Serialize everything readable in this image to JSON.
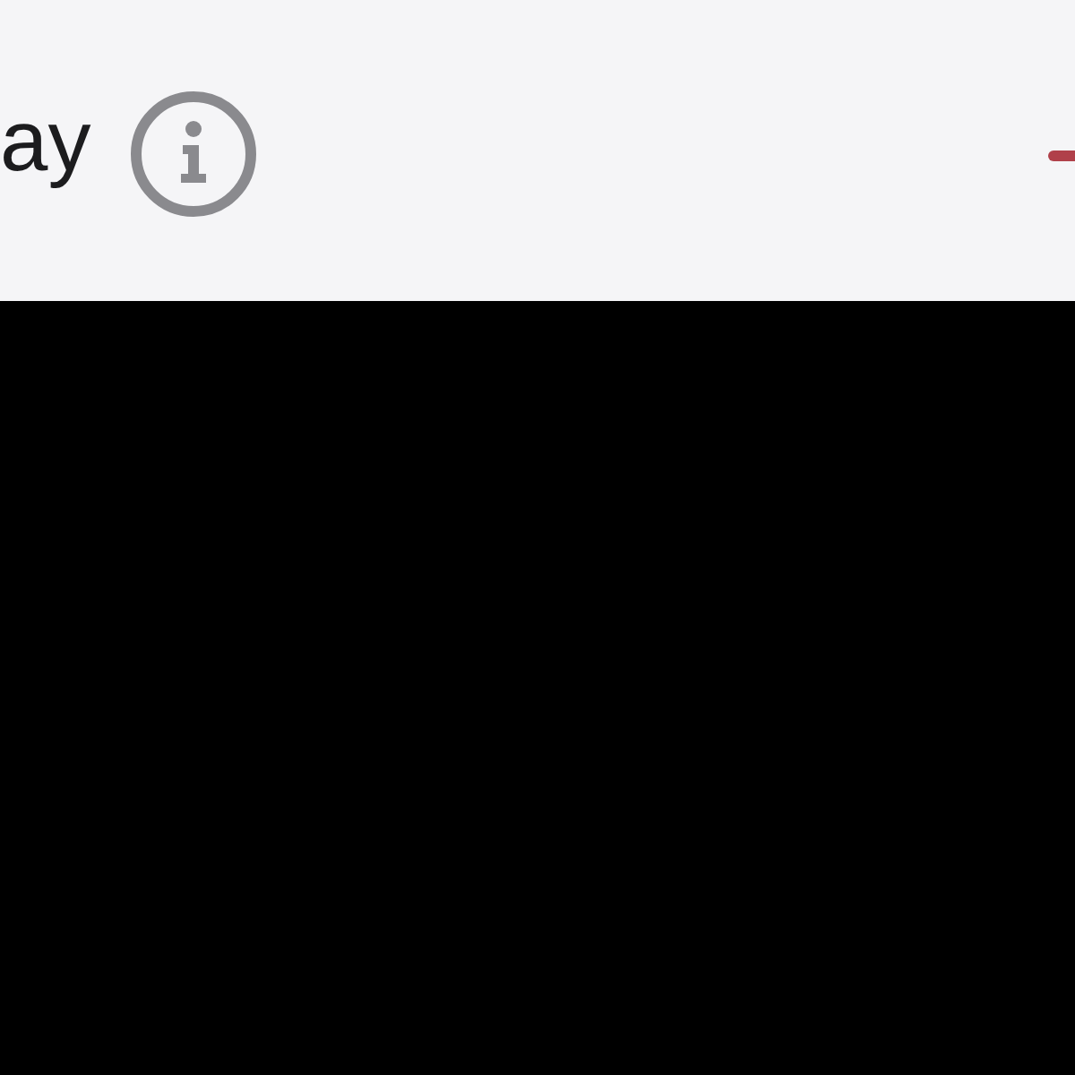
{
  "header": {
    "title": "ay"
  }
}
